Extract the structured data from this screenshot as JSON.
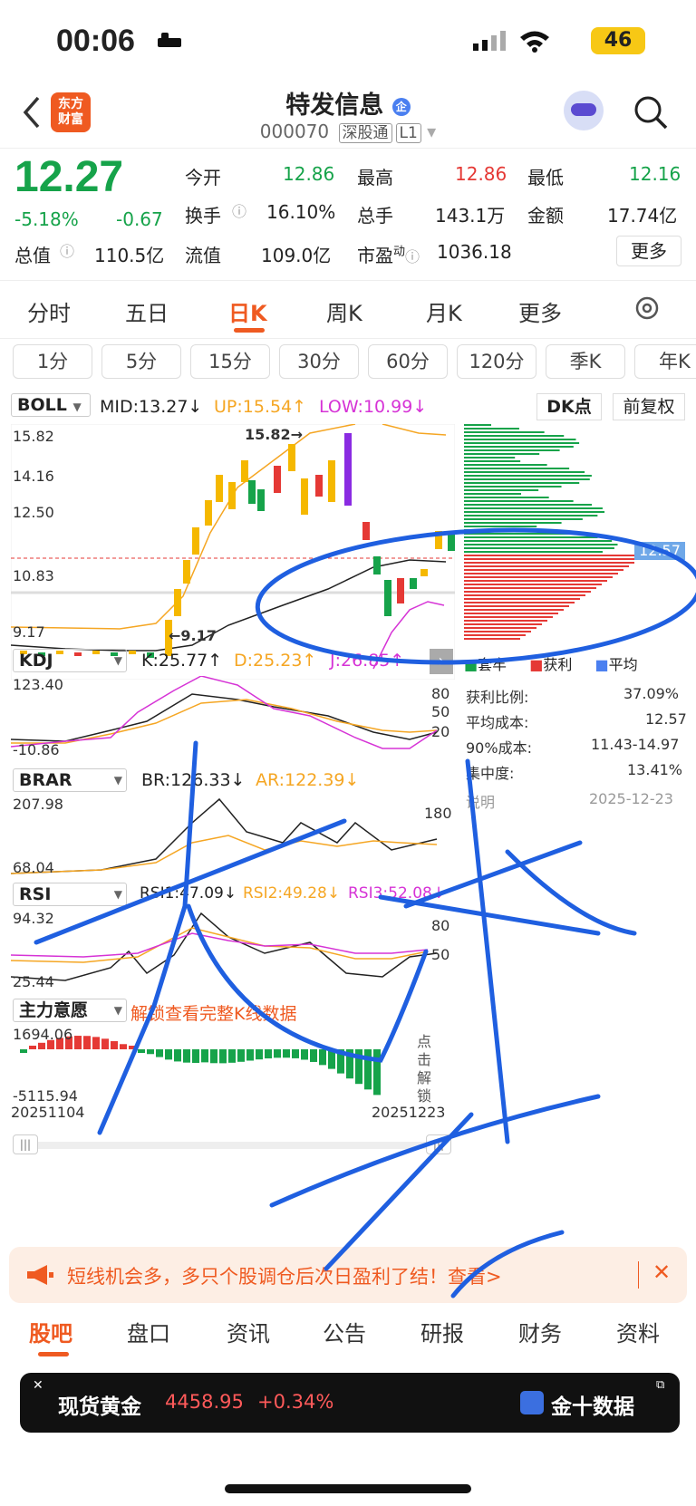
{
  "status": {
    "time": "00:06",
    "network": "46"
  },
  "header": {
    "name": "特发信息",
    "code": "000070",
    "market_tag": "深股通",
    "level": "L1",
    "logo_line1": "东方",
    "logo_line2": "财富"
  },
  "quote": {
    "price": "12.27",
    "pct": "-5.18%",
    "chg": "-0.67",
    "mktcap_label": "总值",
    "mktcap": "110.5亿",
    "open_label": "今开",
    "open": "12.86",
    "turnover_label": "换手",
    "turnover": "16.10%",
    "float_label": "流值",
    "float": "109.0亿",
    "high_label": "最高",
    "high": "12.86",
    "volume_label": "总手",
    "volume": "143.1万",
    "pe_label": "市盈",
    "pe_sup": "动",
    "pe": "1036.18",
    "low_label": "最低",
    "low": "12.16",
    "amount_label": "金额",
    "amount": "17.74亿",
    "more": "更多"
  },
  "period_tabs": [
    "分时",
    "五日",
    "日K",
    "周K",
    "月K",
    "更多"
  ],
  "minute_tabs": [
    "1分",
    "5分",
    "15分",
    "30分",
    "60分",
    "120分",
    "季K",
    "年K"
  ],
  "boll": {
    "name": "BOLL",
    "mid": "MID:13.27↓",
    "up": "UP:15.54↑",
    "low": "LOW:10.99↓",
    "dk": "DK点",
    "adj": "前复权",
    "y": [
      "15.82",
      "14.16",
      "12.50",
      "10.83",
      "9.17"
    ],
    "hi_mark": "15.82→",
    "lo_mark": "←9.17",
    "current": "12.57"
  },
  "legend": {
    "trapped": "套牢",
    "profit": "获利",
    "avg": "平均"
  },
  "chips": {
    "profit_ratio_label": "获利比例:",
    "profit_ratio": "37.09%",
    "avg_cost_label": "平均成本:",
    "avg_cost": "12.57",
    "cost90_label": "90%成本:",
    "cost90": "11.43-14.97",
    "conc_label": "集中度:",
    "conc": "13.41%",
    "note": "说明",
    "date": "2025-12-23"
  },
  "kdj": {
    "name": "KDJ",
    "k": "K:25.77↑",
    "d": "D:25.23↑",
    "j": "J:26.85↑",
    "top": "123.40",
    "bot": "-10.86",
    "r1": "80",
    "r2": "50",
    "r3": "20"
  },
  "brar": {
    "name": "BRAR",
    "br": "BR:126.33↓",
    "ar": "AR:122.39↓",
    "top": "207.98",
    "bot": "68.04",
    "r1": "180"
  },
  "rsi": {
    "name": "RSI",
    "r1v": "RSI1:47.09↓",
    "r2v": "RSI2:49.28↓",
    "r3v": "RSI3:52.08↓",
    "top": "94.32",
    "bot": "25.44",
    "m1": "80",
    "m2": "50"
  },
  "power": {
    "name": "主力意愿",
    "unlock": "解锁查看完整K线数据",
    "top": "1694.06",
    "bot": "-5115.94",
    "side": "点击解锁"
  },
  "dates": {
    "start": "20251104",
    "end": "20251223"
  },
  "banner": {
    "text": "短线机会多，多只个股调仓后次日盈利了结！查看>"
  },
  "bottom_tabs": [
    "股吧",
    "盘口",
    "资讯",
    "公告",
    "研报",
    "财务",
    "资料"
  ],
  "gold": {
    "name": "现货黄金",
    "price": "4458.95",
    "chg": "+0.34%",
    "brand": "金十数据"
  },
  "colors": {
    "up": "#e53935",
    "down": "#16a34a",
    "accent": "#ef5a21"
  }
}
